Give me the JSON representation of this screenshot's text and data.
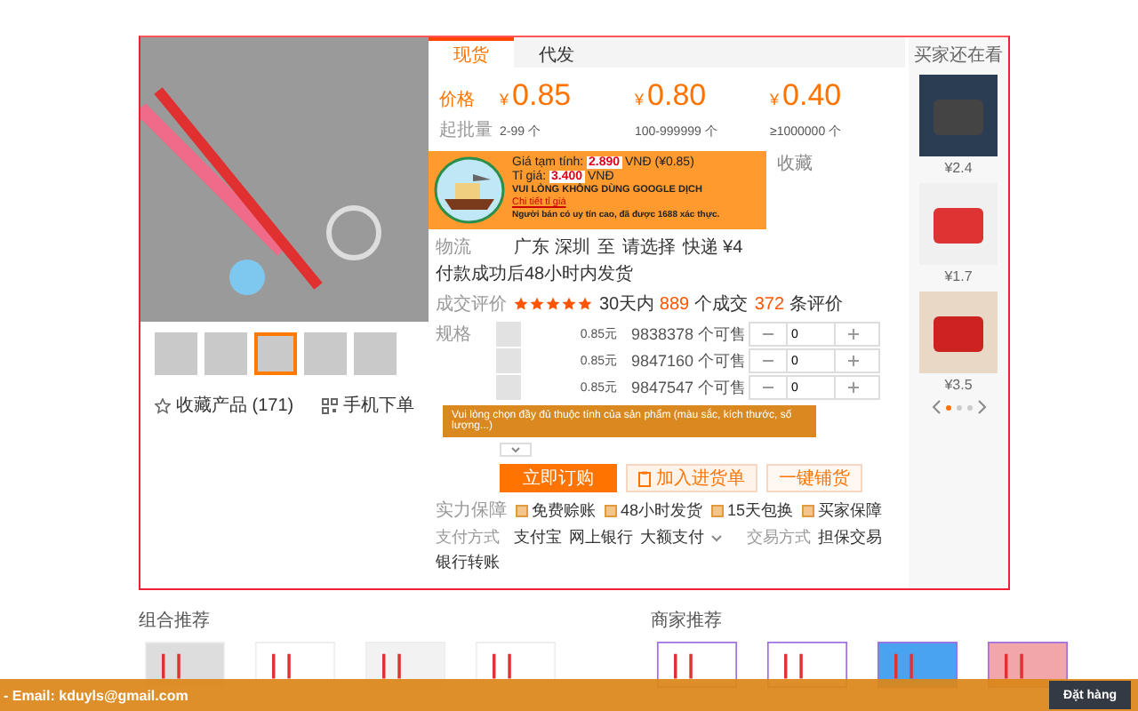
{
  "gallery": {
    "thumbnails": [
      {
        "selected": false
      },
      {
        "selected": false
      },
      {
        "selected": true
      },
      {
        "selected": false
      },
      {
        "selected": false
      }
    ],
    "favorite": "收藏产品 (171)",
    "mobile_order": "手机下单"
  },
  "tabs": [
    {
      "label": "现货",
      "selected": true
    },
    {
      "label": "代发",
      "selected": false
    }
  ],
  "pricing": {
    "price_label": "价格",
    "qty_label": "起批量",
    "tiers": [
      {
        "currency": "¥",
        "price": "0.85",
        "qty": "2-99 个"
      },
      {
        "currency": "¥",
        "price": "0.80",
        "qty": "100-999999 个"
      },
      {
        "currency": "¥",
        "price": "0.40",
        "qty": "≥1000000 个"
      }
    ]
  },
  "banner": {
    "estimate_label": "Giá tạm tính:",
    "estimate_value": "2.890",
    "estimate_unit": "VNĐ (¥0.85)",
    "rate_label": "Tỉ giá:",
    "rate_value": "3.400",
    "rate_unit": "VNĐ",
    "notice": "VUI LÒNG KHÔNG DÙNG GOOGLE DỊCH",
    "link": "Chi tiết tỉ giá",
    "note": "Người bán có uy tín cao, đã được 1688 xác thực.",
    "favorite": "收藏"
  },
  "logistics": {
    "label": "物流",
    "origin": "广东 深圳",
    "to": "至",
    "destination": "请选择",
    "shipping": "快递 ¥4",
    "promise": "付款成功后48小时内发货"
  },
  "reviews": {
    "label": "成交评价",
    "stars": 5,
    "period": "30天内",
    "sold": "889",
    "sold_unit": "个成交",
    "count": "372",
    "count_unit": "条评价"
  },
  "sku": {
    "label": "规格",
    "rows": [
      {
        "price": "0.85元",
        "stock": "9838378 个可售",
        "qty": "0"
      },
      {
        "price": "0.85元",
        "stock": "9847160 个可售",
        "qty": "0"
      },
      {
        "price": "0.85元",
        "stock": "9847547 个可售",
        "qty": "0"
      }
    ]
  },
  "tooltip": "Vui lòng chọn đầy đủ thuộc tính của sản phẩm (màu sắc, kích thước, số lượng...)",
  "actions": [
    {
      "label": "立即订购",
      "kind": "primary"
    },
    {
      "label": "加入进货单",
      "kind": "secondary"
    },
    {
      "label": "一键铺货",
      "kind": "plain"
    }
  ],
  "guarantees": {
    "label": "实力保障",
    "items": [
      "免费赊账",
      "48小时发货",
      "15天包换",
      "买家保障"
    ]
  },
  "payment": {
    "label": "支付方式",
    "items": [
      "支付宝",
      "网上银行",
      "大额支付"
    ],
    "trade_label": "交易方式",
    "trade_items": [
      "担保交易",
      "银行转账"
    ]
  },
  "side": {
    "title": "买家还在看",
    "items": [
      {
        "price": "¥2.4"
      },
      {
        "price": "¥1.7"
      },
      {
        "price": "¥3.5"
      }
    ],
    "pages": [
      {
        "selected": true
      },
      {
        "selected": false
      },
      {
        "selected": false
      }
    ]
  },
  "recommendations": [
    {
      "title": "组合推荐"
    },
    {
      "title": "商家推荐"
    }
  ],
  "order_bar": {
    "text": "- Email: kduyls@gmail.com",
    "button": "Đặt hàng"
  }
}
